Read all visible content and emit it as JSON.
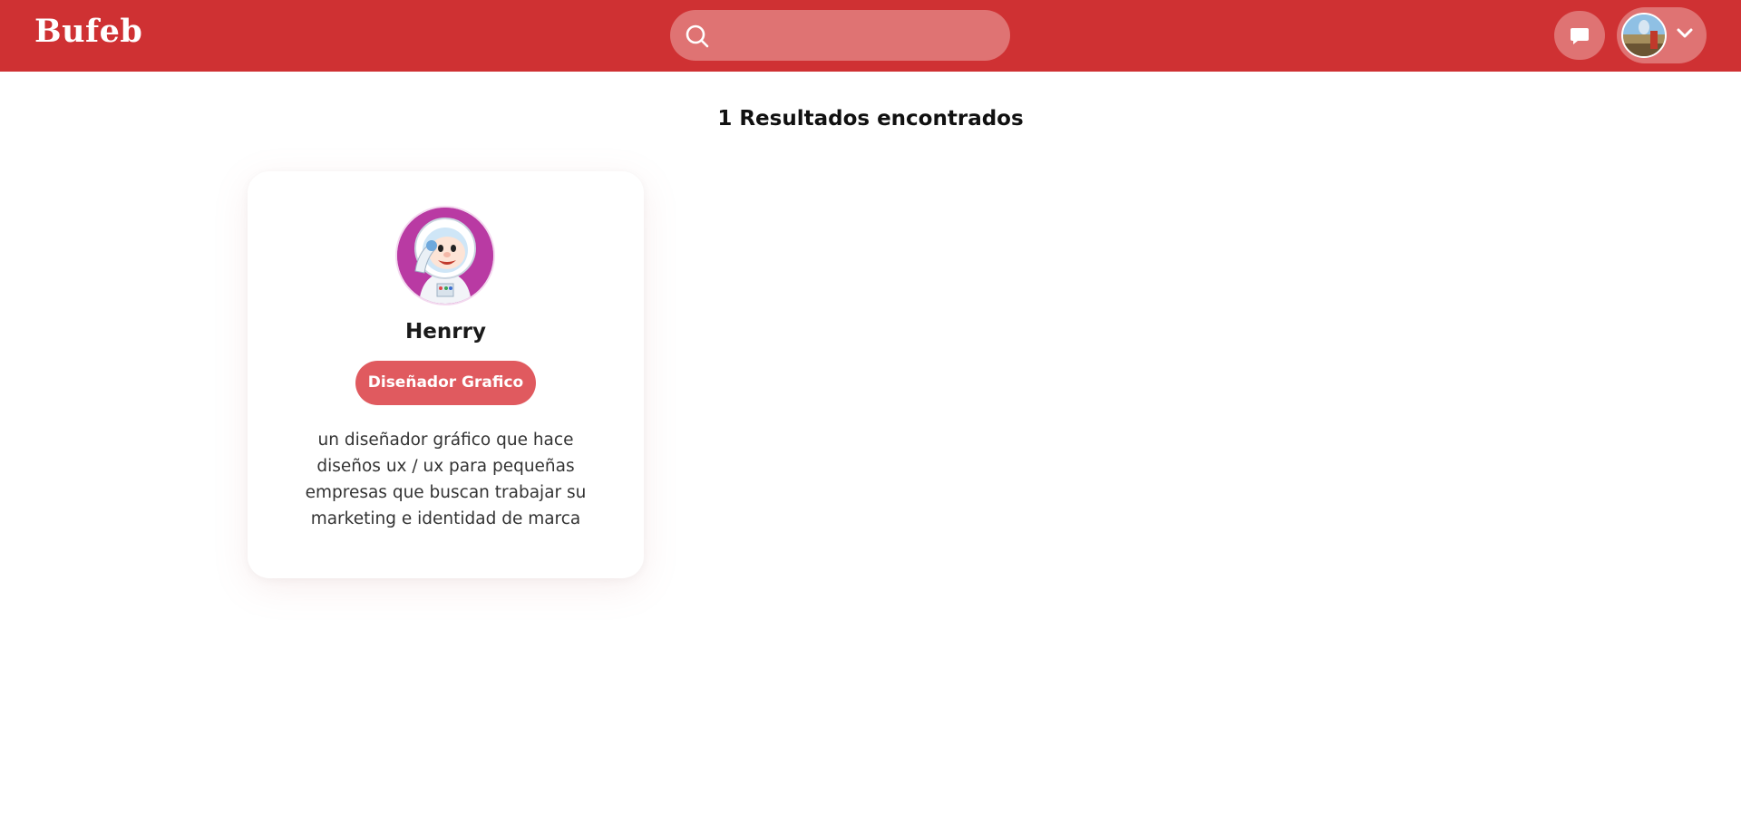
{
  "header": {
    "logo": "Bufeb",
    "search": {
      "placeholder": "",
      "value": ""
    },
    "chat_icon": "chat-bubble-icon",
    "user_avatar": "user-avatar",
    "menu_icon": "chevron-down-icon"
  },
  "results": {
    "count_label": "1 Resultados encontrados"
  },
  "profiles": [
    {
      "name": "Henrry",
      "role": "Diseñador Grafico",
      "description": "un diseñador gráfico que hace diseños ux / ux para pequeñas empresas que buscan trabajar su marketing e identidad de marca"
    }
  ],
  "colors": {
    "brand": "#cf3133",
    "pill": "#df7373",
    "role_badge": "#e05a5f"
  }
}
